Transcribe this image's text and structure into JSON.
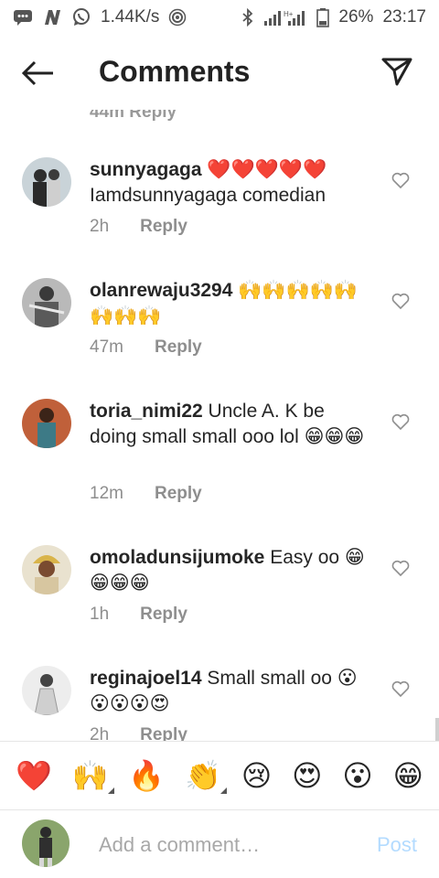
{
  "status": {
    "speed": "1.44K/s",
    "battery": "26%",
    "time": "23:17"
  },
  "header": {
    "title": "Comments"
  },
  "partial": {
    "meta": "44m   Reply"
  },
  "comments": [
    {
      "username": "sunnyagaga",
      "text": " ❤️❤️❤️❤️❤️ Iamdsunnyagaga comedian",
      "time": "2h",
      "reply": "Reply"
    },
    {
      "username": "olanrewaju3294",
      "text": " 🙌🙌🙌🙌🙌🙌🙌🙌",
      "time": "47m",
      "reply": "Reply"
    },
    {
      "username": "toria_nimi22",
      "text": " Uncle A. K be doing small small ooo lol 😁😁😁",
      "time": "12m",
      "reply": "Reply"
    },
    {
      "username": "omoladunsijumoke",
      "text": " Easy oo 😁😁😁😁",
      "time": "1h",
      "reply": "Reply"
    },
    {
      "username": "reginajoel14",
      "text": " Small small oo 😮😮😮😮😍",
      "time": "2h",
      "reply": "Reply"
    }
  ],
  "emoji_bar": [
    "❤️",
    "🙌",
    "🔥",
    "👏",
    "😢",
    "😍",
    "😮",
    "😁"
  ],
  "composer": {
    "placeholder": "Add a comment…",
    "post": "Post"
  }
}
